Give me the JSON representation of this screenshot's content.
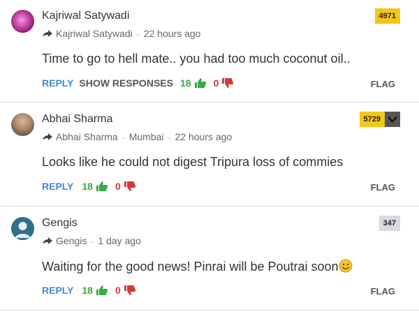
{
  "comments": [
    {
      "author": "Kajriwal Satywadi",
      "reply_to": "Kajriwal Satywadi",
      "location": "",
      "time": "22 hours ago",
      "points": "4971",
      "text": "Time to go to hell mate.. you had too much coconut oil..",
      "reply_label": "REPLY",
      "show_responses_label": "SHOW RESPONSES",
      "upvotes": "18",
      "downvotes": "0",
      "flag_label": "FLAG"
    },
    {
      "author": "Abhai Sharma",
      "reply_to": "Abhai Sharma",
      "location": "Mumbai",
      "time": "22 hours ago",
      "points": "5729",
      "text": "Looks like he could not digest Tripura loss of commies",
      "reply_label": "REPLY",
      "upvotes": "18",
      "downvotes": "0",
      "flag_label": "FLAG"
    },
    {
      "author": "Gengis",
      "reply_to": "Gengis",
      "location": "",
      "time": "1 day ago",
      "points": "347",
      "text": "Waiting for the good news! Pinrai will be Poutrai soon",
      "reply_label": "REPLY",
      "upvotes": "18",
      "downvotes": "0",
      "flag_label": "FLAG"
    }
  ],
  "colors": {
    "reply": "#3d8bd1",
    "upvote": "#39a845",
    "downvote": "#d23b3b",
    "points_gold": "#f5c518",
    "points_gray": "#d6dbe0"
  },
  "icons": [
    "reply-arrow-icon",
    "thumbs-up-icon",
    "thumbs-down-icon",
    "chevron-down-icon",
    "smiley-emoji-icon"
  ]
}
